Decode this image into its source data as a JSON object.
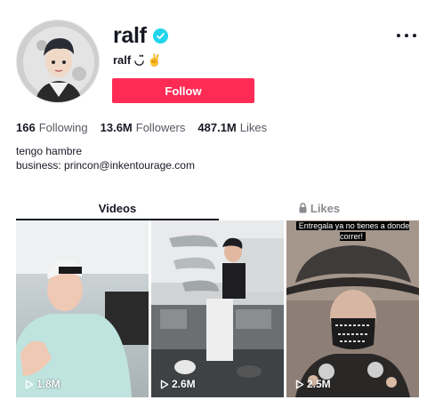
{
  "profile": {
    "username": "ralf",
    "nickname": "ralf ◡̈ ✌",
    "follow_label": "Follow",
    "verified": true,
    "accent_color": "#fe2c55",
    "verified_color": "#20d5ec"
  },
  "stats": {
    "following_count": "166",
    "following_label": "Following",
    "followers_count": "13.6M",
    "followers_label": "Followers",
    "likes_count": "487.1M",
    "likes_label": "Likes"
  },
  "bio": {
    "line1": "tengo hambre",
    "line2": "business: princon@inkentourage.com"
  },
  "tabs": {
    "videos": "Videos",
    "likes": "Likes"
  },
  "videos": [
    {
      "views": "1.8M",
      "caption": ""
    },
    {
      "views": "2.6M",
      "caption": ""
    },
    {
      "views": "2.5M",
      "caption": "Entregala ya no tienes a donde correr!"
    }
  ],
  "icons": {
    "verified": "checkmark-badge-icon",
    "more": "more-dots-icon",
    "lock": "lock-icon",
    "play": "play-outline-icon"
  }
}
